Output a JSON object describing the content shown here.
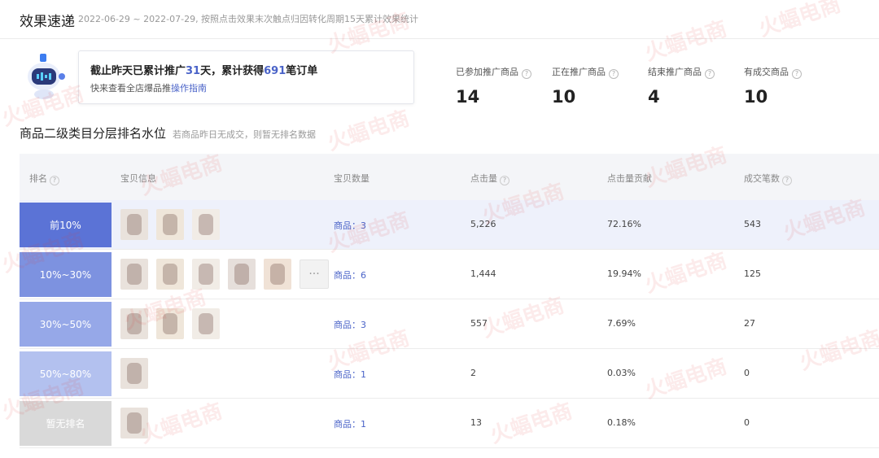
{
  "header": {
    "title": "效果速递",
    "subtitle": "2022-06-29 ~ 2022-07-29, 按照点击效果末次触点归因转化周期15天累计效果统计"
  },
  "summary": {
    "prefix": "截止昨天已累计推广",
    "days": "31",
    "mid": "天，累计获得",
    "orders": "691",
    "suffix": "笔订单",
    "tip_prefix": "快来查看全店爆品推",
    "tip_link": "操作指南"
  },
  "stats": [
    {
      "label": "已参加推广商品",
      "value": "14"
    },
    {
      "label": "正在推广商品",
      "value": "10"
    },
    {
      "label": "结束推广商品",
      "value": "4"
    },
    {
      "label": "有成交商品",
      "value": "10"
    }
  ],
  "section": {
    "title": "商品二级类目分层排名水位",
    "hint": "若商品昨日无成交，则暂无排名数据"
  },
  "columns": {
    "rank": "排名",
    "items": "宝贝信息",
    "count": "宝贝数量",
    "clicks": "点击量",
    "contribution": "点击量贡献",
    "orders": "成交笔数"
  },
  "rows": [
    {
      "rank": "前10%",
      "count": "商品：3",
      "clicks": "5,226",
      "contribution": "72.16%",
      "orders": "543",
      "thumbs": 3,
      "more": false
    },
    {
      "rank": "10%~30%",
      "count": "商品：6",
      "clicks": "1,444",
      "contribution": "19.94%",
      "orders": "125",
      "thumbs": 5,
      "more": true
    },
    {
      "rank": "30%~50%",
      "count": "商品：3",
      "clicks": "557",
      "contribution": "7.69%",
      "orders": "27",
      "thumbs": 3,
      "more": false
    },
    {
      "rank": "50%~80%",
      "count": "商品：1",
      "clicks": "2",
      "contribution": "0.03%",
      "orders": "0",
      "thumbs": 1,
      "more": false
    },
    {
      "rank": "暂无排名",
      "count": "商品：1",
      "clicks": "13",
      "contribution": "0.18%",
      "orders": "0",
      "thumbs": 1,
      "more": false
    }
  ],
  "more_label": "···",
  "watermark": "火蝠电商",
  "colors": {
    "accent": "#4a63c8",
    "rank_bgs": [
      "#5b73d6",
      "#7d92e0",
      "#96a8e8",
      "#b3c1ef",
      "#d9d9d9"
    ]
  }
}
